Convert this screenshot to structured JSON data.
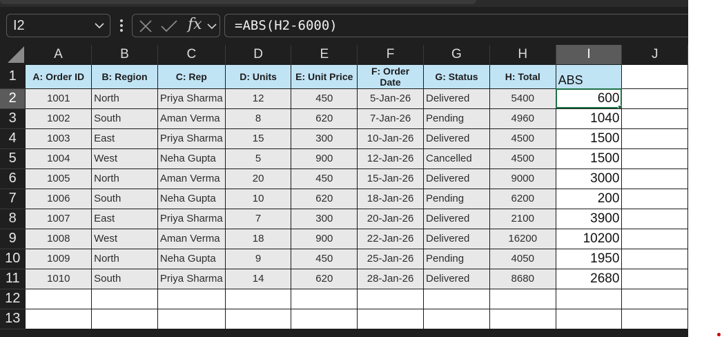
{
  "formula_bar": {
    "name_box": "I2",
    "fx_label": "fx",
    "formula": "=ABS(H2-6000)"
  },
  "columns": [
    "A",
    "B",
    "C",
    "D",
    "E",
    "F",
    "G",
    "H",
    "I",
    "J"
  ],
  "headers": {
    "A": "A: Order ID",
    "B": "B: Region",
    "C": "C: Rep",
    "D": "D: Units",
    "E": "E: Unit Price",
    "F": "F: Order Date",
    "G": "G: Status",
    "H": "H: Total",
    "I": "ABS"
  },
  "row_numbers": [
    "1",
    "2",
    "3",
    "4",
    "5",
    "6",
    "7",
    "8",
    "9",
    "10",
    "11",
    "12",
    "13"
  ],
  "rows": [
    {
      "id": "1001",
      "region": "North",
      "rep": "Priya Sharma",
      "units": "12",
      "price": "450",
      "date": "5-Jan-26",
      "status": "Delivered",
      "total": "5400",
      "abs": "600"
    },
    {
      "id": "1002",
      "region": "South",
      "rep": "Aman Verma",
      "units": "8",
      "price": "620",
      "date": "7-Jan-26",
      "status": "Pending",
      "total": "4960",
      "abs": "1040"
    },
    {
      "id": "1003",
      "region": "East",
      "rep": "Priya Sharma",
      "units": "15",
      "price": "300",
      "date": "10-Jan-26",
      "status": "Delivered",
      "total": "4500",
      "abs": "1500"
    },
    {
      "id": "1004",
      "region": "West",
      "rep": "Neha Gupta",
      "units": "5",
      "price": "900",
      "date": "12-Jan-26",
      "status": "Cancelled",
      "total": "4500",
      "abs": "1500"
    },
    {
      "id": "1005",
      "region": "North",
      "rep": "Aman Verma",
      "units": "20",
      "price": "450",
      "date": "15-Jan-26",
      "status": "Delivered",
      "total": "9000",
      "abs": "3000"
    },
    {
      "id": "1006",
      "region": "South",
      "rep": "Neha Gupta",
      "units": "10",
      "price": "620",
      "date": "18-Jan-26",
      "status": "Pending",
      "total": "6200",
      "abs": "200"
    },
    {
      "id": "1007",
      "region": "East",
      "rep": "Priya Sharma",
      "units": "7",
      "price": "300",
      "date": "20-Jan-26",
      "status": "Delivered",
      "total": "2100",
      "abs": "3900"
    },
    {
      "id": "1008",
      "region": "West",
      "rep": "Aman Verma",
      "units": "18",
      "price": "900",
      "date": "22-Jan-26",
      "status": "Delivered",
      "total": "16200",
      "abs": "10200"
    },
    {
      "id": "1009",
      "region": "North",
      "rep": "Neha Gupta",
      "units": "9",
      "price": "450",
      "date": "25-Jan-26",
      "status": "Pending",
      "total": "4050",
      "abs": "1950"
    },
    {
      "id": "1010",
      "region": "South",
      "rep": "Priya Sharma",
      "units": "14",
      "price": "620",
      "date": "28-Jan-26",
      "status": "Delivered",
      "total": "8680",
      "abs": "2680"
    }
  ],
  "selected_cell": "I2",
  "colors": {
    "header_fill": "#c1e4f5",
    "data_fill": "#e8e8e8",
    "selection": "#1e7145",
    "chrome": "#1f1f1f"
  }
}
